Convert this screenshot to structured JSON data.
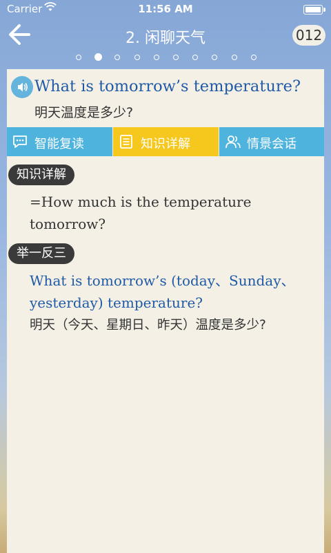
{
  "status": {
    "carrier": "Carrier",
    "time": "11:56 AM"
  },
  "nav": {
    "title": "2. 闲聊天气",
    "counter": "012",
    "back_icon": "back-arrow-icon"
  },
  "pager": {
    "total": 10,
    "active_index": 1
  },
  "card": {
    "question_en": "What is tomorrow’s temperature?",
    "question_cn": "明天温度是多少?",
    "tabs": [
      {
        "label": "智能复读",
        "icon": "chat-icon"
      },
      {
        "label": "知识详解",
        "icon": "document-icon"
      },
      {
        "label": "情景会话",
        "icon": "people-icon"
      }
    ],
    "knowledge": {
      "tag": "知识详解",
      "text": "=How much is the temperature tomorrow?"
    },
    "example": {
      "tag": "举一反三",
      "text_en": "What is tomorrow’s (today、Sunday、yesterday) temperature?",
      "text_cn": "明天（今天、星期日、昨天）温度是多少?"
    }
  },
  "colors": {
    "tab_blue": "#4eb3dd",
    "tab_active": "#f6c71c",
    "english_text": "#1f5aa6",
    "card_bg": "#f4f0e6"
  }
}
